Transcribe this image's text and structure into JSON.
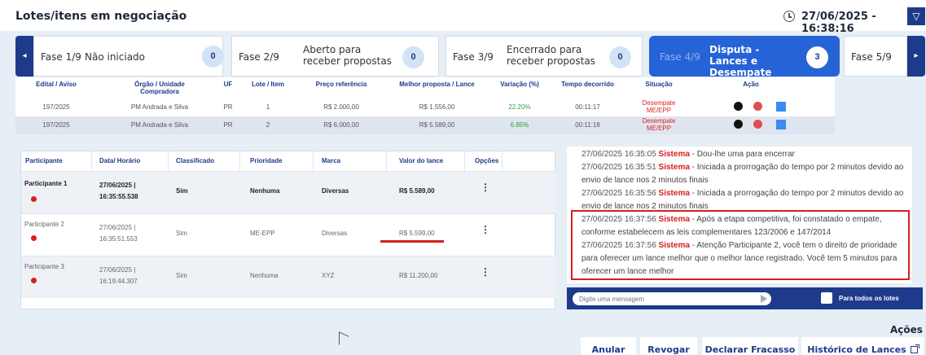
{
  "header": {
    "title": "Lotes/itens em negociação",
    "datetime": "27/06/2025 - 16:38:16"
  },
  "phases": [
    {
      "num": "Fase 1/9",
      "name": "Não iniciado",
      "count": "0"
    },
    {
      "num": "Fase 2/9",
      "name": "Aberto para receber propostas",
      "count": "0"
    },
    {
      "num": "Fase 3/9",
      "name": "Encerrado para receber propostas",
      "count": "0"
    },
    {
      "num": "Fase 4/9",
      "name": "Disputa - Lances e Desempate",
      "count": "3"
    },
    {
      "num": "Fase 5/9"
    }
  ],
  "lots": {
    "headers": [
      "Edital / Aviso",
      "Órgão / Unidade Compradora",
      "UF",
      "Lote / Item",
      "Preço referência",
      "Melhor proposta / Lance",
      "Variação (%)",
      "Tempo decorrido",
      "Situação",
      "Ação"
    ],
    "rows": [
      {
        "edital": "197/2025",
        "orgao": "PM Andrada e Silva",
        "uf": "PR",
        "lote": "1",
        "preco": "R$ 2.000,00",
        "melhor": "R$ 1.556,00",
        "variacao": "22.20%",
        "tempo": "00:11:17",
        "situacao": "Desempate ME/EPP"
      },
      {
        "edital": "197/2025",
        "orgao": "PM Andrada e Silva",
        "uf": "PR",
        "lote": "2",
        "preco": "R$ 6.000,00",
        "melhor": "R$ 5.589,00",
        "variacao": "6.85%",
        "tempo": "00:11:18",
        "situacao": "Desempate ME/EPP"
      }
    ]
  },
  "bids": {
    "headers": [
      "Participante",
      "Data/ Horário",
      "Classificado",
      "Prioridade",
      "Marca",
      "Valor do lance",
      "Opções"
    ],
    "rows": [
      {
        "participante": "Participante 1",
        "data": "27/06/2025 |",
        "hora": "16:35:55.538",
        "classificado": "Sim",
        "prioridade": "Nenhuma",
        "marca": "Diversas",
        "valor": "R$ 5.589,00"
      },
      {
        "participante": "Participante 2",
        "data": "27/06/2025 |",
        "hora": "16:35:51.553",
        "classificado": "Sim",
        "prioridade": "ME-EPP",
        "marca": "Diversas",
        "valor": "R$ 5.599,00"
      },
      {
        "participante": "Participante 3",
        "data": "27/06/2025 |",
        "hora": "16:19:44.307",
        "classificado": "Sim",
        "prioridade": "Nenhuma",
        "marca": "XYZ",
        "valor": "R$ 11.200,00"
      }
    ]
  },
  "chat": {
    "messages": [
      {
        "ts": "27/06/2025 16:35:05",
        "sender": "Sistema",
        "text": " - Dou-lhe uma para encerrar"
      },
      {
        "ts": "27/06/2025 16:35:51",
        "sender": "Sistema",
        "text": " - Iniciada a prorrogação do tempo por 2 minutos devido ao envio de lance nos 2 minutos finais"
      },
      {
        "ts": "27/06/2025 16:35:56",
        "sender": "Sistema",
        "text": " - Iniciada a prorrogação do tempo por 2 minutos devido ao envio de lance nos 2 minutos finais"
      },
      {
        "ts": "27/06/2025 16:37:56",
        "sender": "Sistema",
        "text": " - Após a etapa competitiva, foi constatado o empate, conforme estabelecem as leis complementares 123/2006 e 147/2014"
      },
      {
        "ts": "27/06/2025 16:37:56",
        "sender": "Sistema",
        "text": " - Atenção Participante 2, você tem o direito de prioridade para oferecer um lance melhor que o melhor lance registrado. Você tem 5 minutos para oferecer um lance melhor"
      }
    ],
    "input_placeholder": "Digite uma mensagem",
    "all_lots_label": "Para todos os lotes"
  },
  "actions": {
    "title": "Ações",
    "anular": "Anular",
    "revogar": "Revogar",
    "declarar": "Declarar Fracasso",
    "historico": "Histórico de Lances"
  },
  "colors": {
    "accent": "#1e3a8a",
    "active_phase": "#2563d6",
    "system_red": "#d61f1f",
    "positive_green": "#2e9e3a"
  }
}
